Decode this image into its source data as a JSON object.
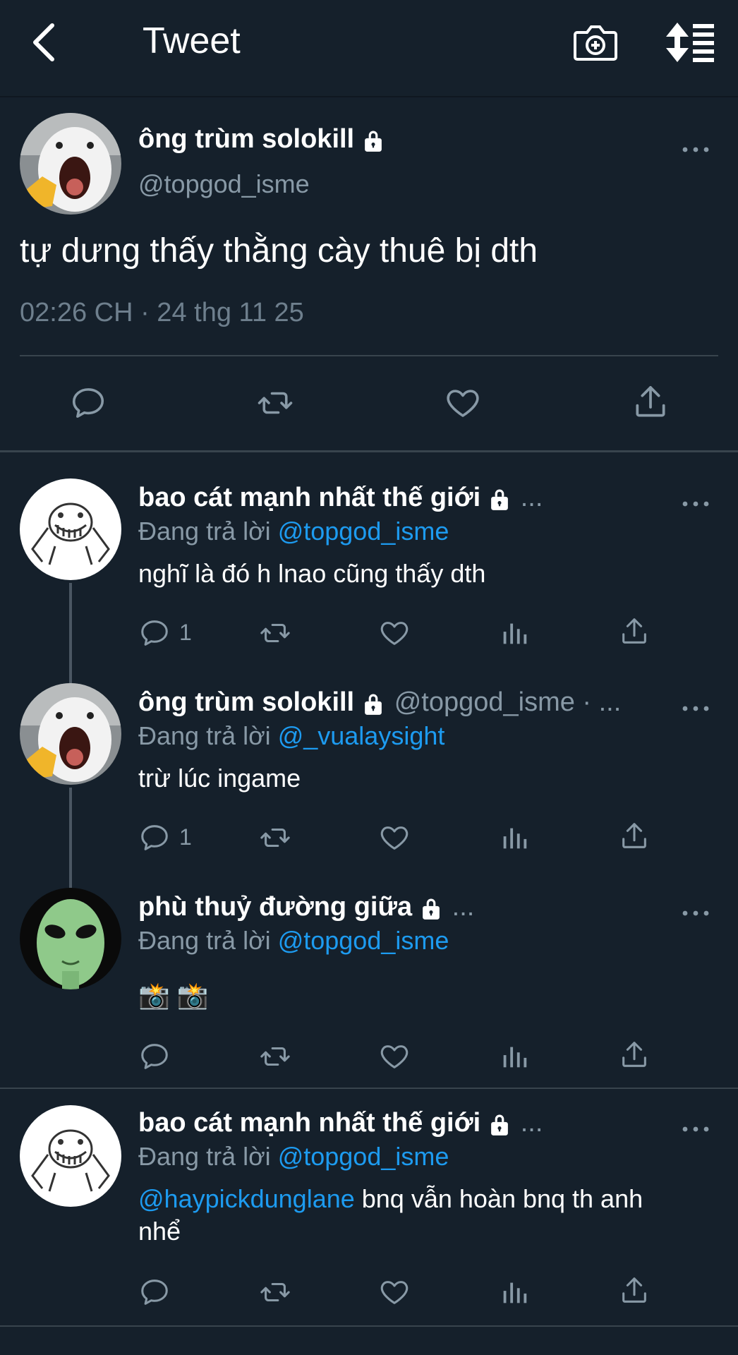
{
  "header": {
    "title": "Tweet"
  },
  "main_tweet": {
    "name": "ông trùm solokill",
    "handle": "@topgod_isme",
    "text": "tự dưng thấy thằng cày thuê bị dth",
    "timestamp": "02:26 CH · 24 thg 11 25"
  },
  "replies": [
    {
      "name": "bao cát mạnh nhất thế giới",
      "name_suffix": "...",
      "replying_prefix": "Đang trả lời ",
      "replying_to": "@topgod_isme",
      "text": "nghĩ là đó h lnao cũng thấy dth",
      "reply_count": "1"
    },
    {
      "name": "ông trùm solokill",
      "name_suffix": "@topgod_isme · ...",
      "replying_prefix": "Đang trả lời ",
      "replying_to": "@_vualaysight",
      "text": "trừ lúc ingame",
      "reply_count": "1"
    },
    {
      "name": "phù thuỷ đường giữa",
      "name_suffix": "...",
      "replying_prefix": "Đang trả lời ",
      "replying_to": "@topgod_isme",
      "text": "📸 📸"
    },
    {
      "name": "bao cát mạnh nhất thế giới",
      "name_suffix": "...",
      "replying_prefix": "Đang trả lời ",
      "replying_to": "@topgod_isme",
      "mention": "@haypickdunglane",
      "text": " bnq vẫn hoàn bnq th anh nhể"
    }
  ],
  "icons": {
    "back": "chevron-left-icon",
    "camera": "camera-plus-icon",
    "sort": "sort-icon",
    "lock": "lock-icon",
    "reply": "reply-icon",
    "retweet": "retweet-icon",
    "like": "heart-icon",
    "analytics": "analytics-icon",
    "share": "share-icon",
    "more": "more-icon"
  },
  "colors": {
    "background": "#15202b",
    "link": "#1d9bf0",
    "secondary": "#8899a6"
  }
}
